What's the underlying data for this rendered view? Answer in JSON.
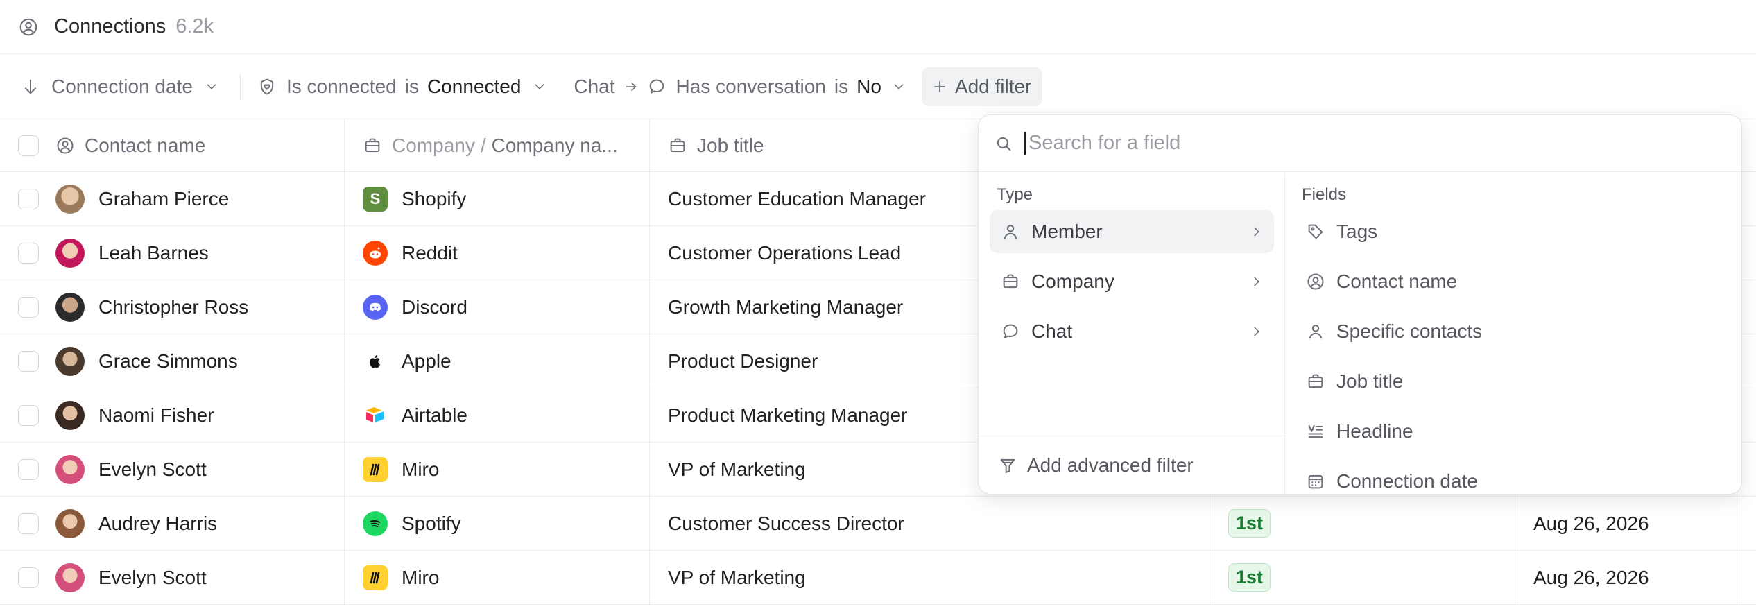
{
  "header": {
    "title": "Connections",
    "count": "6.2k"
  },
  "filters": {
    "sort_label": "Connection date",
    "filter1": {
      "field": "Is connected",
      "op": "is",
      "value": "Connected"
    },
    "filter2": {
      "group": "Chat",
      "field": "Has conversation",
      "op": "is",
      "value": "No"
    },
    "add_filter": "Add filter"
  },
  "table": {
    "columns": {
      "name": "Contact name",
      "company_prefix": "Company",
      "company_sep": "/",
      "company_field": "Company na...",
      "job": "Job title"
    },
    "rows": [
      {
        "name": "Graham Pierce",
        "company": "Shopify",
        "job": "Customer Education Manager",
        "conn": "",
        "date": ""
      },
      {
        "name": "Leah Barnes",
        "company": "Reddit",
        "job": "Customer Operations Lead",
        "conn": "",
        "date": ""
      },
      {
        "name": "Christopher Ross",
        "company": "Discord",
        "job": "Growth Marketing Manager",
        "conn": "",
        "date": ""
      },
      {
        "name": "Grace Simmons",
        "company": "Apple",
        "job": "Product Designer",
        "conn": "",
        "date": ""
      },
      {
        "name": "Naomi Fisher",
        "company": "Airtable",
        "job": "Product Marketing Manager",
        "conn": "",
        "date": ""
      },
      {
        "name": "Evelyn Scott",
        "company": "Miro",
        "job": "VP of Marketing",
        "conn": "",
        "date": ""
      },
      {
        "name": "Audrey Harris",
        "company": "Spotify",
        "job": "Customer Success Director",
        "conn": "1st",
        "date": "Aug 26, 2026"
      },
      {
        "name": "Evelyn Scott",
        "company": "Miro",
        "job": "VP of Marketing",
        "conn": "1st",
        "date": "Aug 26, 2026"
      }
    ]
  },
  "dropdown": {
    "search_placeholder": "Search for a field",
    "type_heading": "Type",
    "types": [
      "Member",
      "Company",
      "Chat"
    ],
    "fields_heading": "Fields",
    "fields": [
      "Tags",
      "Contact name",
      "Specific contacts",
      "Job title",
      "Headline",
      "Connection date"
    ],
    "advanced": "Add advanced filter"
  },
  "colors": {
    "badge_bg": "#e6f7e9",
    "badge_text": "#1e7d34",
    "shopify": "#5e8e3e",
    "reddit": "#ff4500",
    "discord": "#5865f2",
    "miro": "#ffd02f",
    "spotify": "#1ed760"
  }
}
